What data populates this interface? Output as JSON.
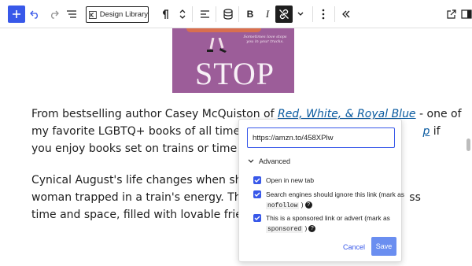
{
  "toolbar": {
    "inserter_icon": "plus-icon",
    "undo_icon": "undo-icon",
    "redo_icon": "redo-icon",
    "list_view_icon": "list-view-icon",
    "design_library_label": "Design Library",
    "paragraph_icon": "pilcrow-icon",
    "move_icon": "chevron-up-down-icon",
    "align_icon": "align-left-icon",
    "database_icon": "database-icon",
    "bold_label": "B",
    "italic_label": "I",
    "unlink_icon": "link-off-icon",
    "more_format_icon": "chevron-down-icon",
    "options_icon": "more-vertical-icon",
    "collapse_icon": "double-chevron-left-icon",
    "external_icon": "external-link-icon",
    "settings_icon": "settings-icon",
    "accent_color": "#3858e9"
  },
  "cover": {
    "title": "STOP",
    "tagline": "Sometimes love stops you in your tracks.",
    "background_color": "#9c5d99"
  },
  "content": {
    "p1": {
      "line1_prefix": "From bestselling author Casey McQuiston of ",
      "line1_link": "Red, White, & Royal Blue",
      "line1_suffix": " - one of",
      "line2_prefix": "my favorite LGBTQ+ books of all time - y",
      "line2_link_tail": "p",
      "line2_suffix": " if",
      "line3": "you enjoy books set on trains or time tra"
    },
    "p2": {
      "line1": "Cynical August's life changes when she m",
      "line2_prefix": "woman trapped in a train's energy. This ",
      "line2_suffix": "ss",
      "line3": "time and space, filled with lovable friend"
    }
  },
  "link_popover": {
    "url_value": "https://amzn.to/458XPlw",
    "advanced_label": "Advanced",
    "options": [
      {
        "label": "Open in new tab",
        "checked": true
      },
      {
        "label_before": "Search engines should ignore this link (mark as",
        "code": "nofollow",
        "label_after": ")",
        "checked": true
      },
      {
        "label_before": "This is a sponsored link or advert (mark as",
        "code": "sponsored",
        "label_after": ")",
        "checked": true
      }
    ],
    "help_glyph": "?",
    "cancel_label": "Cancel",
    "save_label": "Save"
  }
}
